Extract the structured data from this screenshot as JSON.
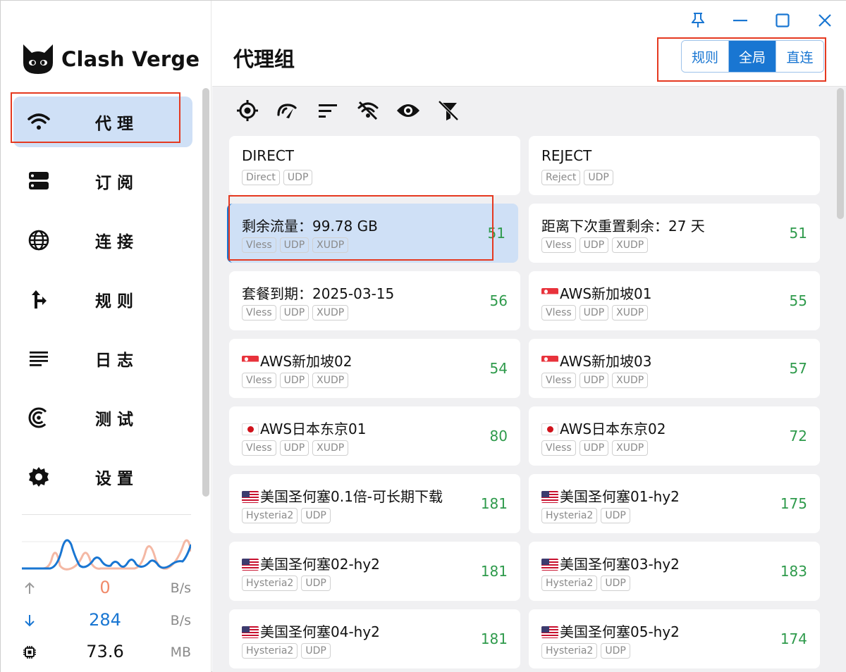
{
  "app": {
    "logo_text": "Clash Verge"
  },
  "sidebar": {
    "items": [
      {
        "label": "代理",
        "icon": "wifi-icon",
        "active": true
      },
      {
        "label": "订阅",
        "icon": "storage-icon",
        "active": false
      },
      {
        "label": "连接",
        "icon": "globe-icon",
        "active": false
      },
      {
        "label": "规则",
        "icon": "fork-arrow-icon",
        "active": false
      },
      {
        "label": "日志",
        "icon": "list-icon",
        "active": false
      },
      {
        "label": "测试",
        "icon": "radar-icon",
        "active": false
      },
      {
        "label": "设置",
        "icon": "gear-icon",
        "active": false
      }
    ],
    "traffic": {
      "upload": {
        "value": "0",
        "unit": "B/s",
        "icon": "arrow-up-icon",
        "color": "#f08a6a"
      },
      "download": {
        "value": "284",
        "unit": "B/s",
        "icon": "arrow-down-icon",
        "color": "#1976d2"
      },
      "memory": {
        "value": "73.6",
        "unit": "MB",
        "icon": "chip-icon",
        "color": "#111111"
      }
    }
  },
  "header": {
    "title": "代理组",
    "modes": [
      "规则",
      "全局",
      "直连"
    ],
    "selected_mode": "全局",
    "window_controls": [
      "pin-icon",
      "minimize-icon",
      "maximize-icon",
      "close-icon"
    ]
  },
  "toolbar": {
    "icons": [
      "locate-icon",
      "speed-test-icon",
      "sort-icon",
      "filter-off-icon",
      "eye-icon",
      "funnel-off-icon"
    ]
  },
  "proxies": [
    {
      "name": "DIRECT",
      "flag": "",
      "tags": [
        "Direct",
        "UDP"
      ],
      "latency": ""
    },
    {
      "name": "REJECT",
      "flag": "",
      "tags": [
        "Reject",
        "UDP"
      ],
      "latency": ""
    },
    {
      "name": "剩余流量：99.78 GB",
      "flag": "",
      "tags": [
        "Vless",
        "UDP",
        "XUDP"
      ],
      "latency": "51",
      "selected": true
    },
    {
      "name": "距离下次重置剩余：27 天",
      "flag": "",
      "tags": [
        "Vless",
        "UDP",
        "XUDP"
      ],
      "latency": "51"
    },
    {
      "name": "套餐到期：2025-03-15",
      "flag": "",
      "tags": [
        "Vless",
        "UDP",
        "XUDP"
      ],
      "latency": "56"
    },
    {
      "name": "AWS新加坡01",
      "flag": "sg",
      "tags": [
        "Vless",
        "UDP",
        "XUDP"
      ],
      "latency": "55"
    },
    {
      "name": "AWS新加坡02",
      "flag": "sg",
      "tags": [
        "Vless",
        "UDP",
        "XUDP"
      ],
      "latency": "54"
    },
    {
      "name": "AWS新加坡03",
      "flag": "sg",
      "tags": [
        "Vless",
        "UDP",
        "XUDP"
      ],
      "latency": "57"
    },
    {
      "name": "AWS日本东京01",
      "flag": "jp",
      "tags": [
        "Vless",
        "UDP",
        "XUDP"
      ],
      "latency": "80"
    },
    {
      "name": "AWS日本东京02",
      "flag": "jp",
      "tags": [
        "Vless",
        "UDP",
        "XUDP"
      ],
      "latency": "72"
    },
    {
      "name": "美国圣何塞0.1倍-可长期下载",
      "flag": "us",
      "tags": [
        "Hysteria2",
        "UDP"
      ],
      "latency": "181"
    },
    {
      "name": "美国圣何塞01-hy2",
      "flag": "us",
      "tags": [
        "Hysteria2",
        "UDP"
      ],
      "latency": "175"
    },
    {
      "name": "美国圣何塞02-hy2",
      "flag": "us",
      "tags": [
        "Hysteria2",
        "UDP"
      ],
      "latency": "181"
    },
    {
      "name": "美国圣何塞03-hy2",
      "flag": "us",
      "tags": [
        "Hysteria2",
        "UDP"
      ],
      "latency": "183"
    },
    {
      "name": "美国圣何塞04-hy2",
      "flag": "us",
      "tags": [
        "Hysteria2",
        "UDP"
      ],
      "latency": "181"
    },
    {
      "name": "美国圣何塞05-hy2",
      "flag": "us",
      "tags": [
        "Hysteria2",
        "UDP"
      ],
      "latency": "174"
    }
  ],
  "colors": {
    "accent": "#1976d2",
    "latency_good": "#2e9a4b",
    "highlight_box": "#e53920",
    "active_nav_bg": "#cfe0f6"
  }
}
